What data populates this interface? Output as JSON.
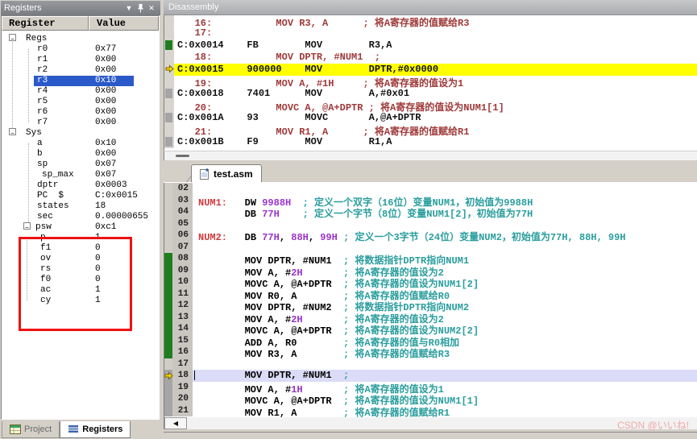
{
  "window": {
    "bg": "#d4d0c8"
  },
  "icons": {
    "dropdown": "▼",
    "close": "✕",
    "scroll_left": "◀",
    "expander": "−"
  },
  "registers_panel": {
    "title": "Registers",
    "header": {
      "register": "Register",
      "value": "Value"
    },
    "selection_color": "#2a5ac9",
    "annotation_color": "#ee1212",
    "rows": [
      {
        "type": "group",
        "level": 0,
        "label": "Regs",
        "value": "",
        "expander": true
      },
      {
        "type": "item",
        "level": 1,
        "label": "r0",
        "value": "0x77"
      },
      {
        "type": "item",
        "level": 1,
        "label": "r1",
        "value": "0x00"
      },
      {
        "type": "item",
        "level": 1,
        "label": "r2",
        "value": "0x00"
      },
      {
        "type": "item",
        "level": 1,
        "label": "r3",
        "value": "0x10",
        "selected": true
      },
      {
        "type": "item",
        "level": 1,
        "label": "r4",
        "value": "0x00"
      },
      {
        "type": "item",
        "level": 1,
        "label": "r5",
        "value": "0x00"
      },
      {
        "type": "item",
        "level": 1,
        "label": "r6",
        "value": "0x00"
      },
      {
        "type": "item",
        "level": 1,
        "label": "r7",
        "value": "0x00"
      },
      {
        "type": "group",
        "level": 0,
        "label": "Sys",
        "value": "",
        "expander": true
      },
      {
        "type": "item",
        "level": 1,
        "label": "a",
        "value": "0x10"
      },
      {
        "type": "item",
        "level": 1,
        "label": "b",
        "value": "0x00"
      },
      {
        "type": "item",
        "level": 1,
        "label": "sp",
        "value": "0x07"
      },
      {
        "type": "item",
        "level": 1.5,
        "label": "sp_max",
        "value": "0x07"
      },
      {
        "type": "item",
        "level": 1,
        "label": "dptr",
        "value": "0x0003"
      },
      {
        "type": "item",
        "level": 1,
        "label": "PC  $",
        "value": "C:0x0015"
      },
      {
        "type": "item",
        "level": 1,
        "label": "states",
        "value": "18"
      },
      {
        "type": "item",
        "level": 1,
        "label": "sec",
        "value": "0.00000655"
      },
      {
        "type": "group",
        "level": 2,
        "label": "psw",
        "value": "0xc1",
        "expander": true,
        "annotated": true
      },
      {
        "type": "item",
        "level": 3,
        "label": "p",
        "value": "1"
      },
      {
        "type": "item",
        "level": 3,
        "label": "f1",
        "value": "0"
      },
      {
        "type": "item",
        "level": 3,
        "label": "ov",
        "value": "0"
      },
      {
        "type": "item",
        "level": 3,
        "label": "rs",
        "value": "0"
      },
      {
        "type": "item",
        "level": 3,
        "label": "f0",
        "value": "0"
      },
      {
        "type": "item",
        "level": 3,
        "label": "ac",
        "value": "1"
      },
      {
        "type": "item",
        "level": 3,
        "label": "cy",
        "value": "1"
      }
    ],
    "tabs": [
      {
        "label": "Project",
        "active": false
      },
      {
        "label": "Registers",
        "active": true
      }
    ]
  },
  "disassembly_panel": {
    "title": "Disassembly",
    "colors": {
      "source_line": "#a03a3a",
      "code_line": "#111111",
      "highlight": "#ffff00",
      "marker_green": "#1f7d1f",
      "marker_gray": "#a5a5a5"
    },
    "lines": [
      {
        "kind": "src",
        "text": "   16:           MOV R3, A      ; 将A寄存器的值赋给R3"
      },
      {
        "kind": "src",
        "text": "   17:"
      },
      {
        "kind": "code",
        "marker": "green",
        "text": "C:0x0014    FB        MOV        R3,A"
      },
      {
        "kind": "src",
        "text": "   18:           MOV DPTR, #NUM1  ;"
      },
      {
        "kind": "code",
        "marker": "arrow",
        "highlight": true,
        "text": "C:0x0015    900000    MOV        DPTR,#0x0000"
      },
      {
        "kind": "src",
        "text": "   19:           MOV A, #1H     ; 将A寄存器的值设为1"
      },
      {
        "kind": "code",
        "marker": "gray",
        "text": "C:0x0018    7401      MOV        A,#0x01"
      },
      {
        "kind": "src",
        "text": "   20:           MOVC A, @A+DPTR ; 将A寄存器的值设为NUM1[1]"
      },
      {
        "kind": "code",
        "marker": "gray",
        "text": "C:0x001A    93        MOVC       A,@A+DPTR"
      },
      {
        "kind": "src",
        "text": "   21:           MOV R1, A      ; 将A寄存器的值赋给R1"
      },
      {
        "kind": "code",
        "marker": "gray",
        "text": "C:0x001B    F9        MOV        R1,A"
      }
    ]
  },
  "editor_panel": {
    "tab": {
      "label": "test.asm"
    },
    "colors": {
      "code": "#000000",
      "com": "#2a9d9d",
      "num": "#9933cc",
      "label": "#d03a3a",
      "current_line": "#dcdcf8"
    },
    "lines": [
      {
        "no": "02",
        "tokens": []
      },
      {
        "no": "03",
        "tokens": [
          {
            "t": "NUM1:",
            "c": "label"
          },
          {
            "t": "   DW ",
            "c": "code"
          },
          {
            "t": "9988H",
            "c": "num"
          },
          {
            "t": "  ",
            "c": "code"
          },
          {
            "t": "; 定义一个双字（16位）变量NUM1，初始值为9988H",
            "c": "com"
          }
        ]
      },
      {
        "no": "04",
        "tokens": [
          {
            "t": "        DB ",
            "c": "code"
          },
          {
            "t": "77H",
            "c": "num"
          },
          {
            "t": "    ",
            "c": "code"
          },
          {
            "t": "; 定义一个字节（8位）变量NUM1[2]，初始值为77H",
            "c": "com"
          }
        ]
      },
      {
        "no": "05",
        "tokens": []
      },
      {
        "no": "06",
        "tokens": [
          {
            "t": "NUM2:",
            "c": "label"
          },
          {
            "t": "   DB ",
            "c": "code"
          },
          {
            "t": "77H",
            "c": "num"
          },
          {
            "t": ", ",
            "c": "code"
          },
          {
            "t": "88H",
            "c": "num"
          },
          {
            "t": ", ",
            "c": "code"
          },
          {
            "t": "99H",
            "c": "num"
          },
          {
            "t": " ",
            "c": "code"
          },
          {
            "t": "; 定义一个3字节（24位）变量NUM2，初始值为77H, 88H, 99H",
            "c": "com"
          }
        ]
      },
      {
        "no": "07",
        "tokens": []
      },
      {
        "no": "08",
        "marker": "green",
        "tokens": [
          {
            "t": "        MOV DPTR, #NUM1  ",
            "c": "code"
          },
          {
            "t": "; 将数据指针DPTR指向NUM1",
            "c": "com"
          }
        ]
      },
      {
        "no": "09",
        "marker": "green",
        "tokens": [
          {
            "t": "        MOV A, #",
            "c": "code"
          },
          {
            "t": "2H",
            "c": "num"
          },
          {
            "t": "       ",
            "c": "code"
          },
          {
            "t": "; 将A寄存器的值设为2",
            "c": "com"
          }
        ]
      },
      {
        "no": "10",
        "marker": "green",
        "tokens": [
          {
            "t": "        MOVC A, @A+DPTR  ",
            "c": "code"
          },
          {
            "t": "; 将A寄存器的值设为NUM1[2]",
            "c": "com"
          }
        ]
      },
      {
        "no": "11",
        "marker": "green",
        "tokens": [
          {
            "t": "        MOV R0, A        ",
            "c": "code"
          },
          {
            "t": "; 将A寄存器的值赋给R0",
            "c": "com"
          }
        ]
      },
      {
        "no": "12",
        "marker": "green",
        "tokens": [
          {
            "t": "        MOV DPTR, #NUM2  ",
            "c": "code"
          },
          {
            "t": "; 将数据指针DPTR指向NUM2",
            "c": "com"
          }
        ]
      },
      {
        "no": "13",
        "marker": "green",
        "tokens": [
          {
            "t": "        MOV A, #",
            "c": "code"
          },
          {
            "t": "2H",
            "c": "num"
          },
          {
            "t": "       ",
            "c": "code"
          },
          {
            "t": "; 将A寄存器的值设为2",
            "c": "com"
          }
        ]
      },
      {
        "no": "14",
        "marker": "green",
        "tokens": [
          {
            "t": "        MOVC A, @A+DPTR  ",
            "c": "code"
          },
          {
            "t": "; 将A寄存器的值设为NUM2[2]",
            "c": "com"
          }
        ]
      },
      {
        "no": "15",
        "marker": "green",
        "tokens": [
          {
            "t": "        ADD A, R0        ",
            "c": "code"
          },
          {
            "t": "; 将A寄存器的值与R0相加",
            "c": "com"
          }
        ]
      },
      {
        "no": "16",
        "marker": "green",
        "tokens": [
          {
            "t": "        MOV R3, A        ",
            "c": "code"
          },
          {
            "t": "; 将A寄存器的值赋给R3",
            "c": "com"
          }
        ]
      },
      {
        "no": "17",
        "tokens": []
      },
      {
        "no": "18",
        "marker": "gray",
        "arrow": true,
        "current": true,
        "tokens": [
          {
            "t": "        MOV DPTR, #NUM1  ",
            "c": "code"
          },
          {
            "t": ";",
            "c": "com"
          }
        ]
      },
      {
        "no": "19",
        "marker": "gray",
        "tokens": [
          {
            "t": "        MOV A, #",
            "c": "code"
          },
          {
            "t": "1H",
            "c": "num"
          },
          {
            "t": "       ",
            "c": "code"
          },
          {
            "t": "; 将A寄存器的值设为1",
            "c": "com"
          }
        ]
      },
      {
        "no": "20",
        "marker": "gray",
        "tokens": [
          {
            "t": "        MOVC A, @A+DPTR  ",
            "c": "code"
          },
          {
            "t": "; 将A寄存器的值设为NUM1[1]",
            "c": "com"
          }
        ]
      },
      {
        "no": "21",
        "marker": "gray",
        "tokens": [
          {
            "t": "        MOV R1, A        ",
            "c": "code"
          },
          {
            "t": "; 将A寄存器的值赋给R1",
            "c": "com"
          }
        ]
      }
    ]
  },
  "watermark": "CSDN @いいね!"
}
